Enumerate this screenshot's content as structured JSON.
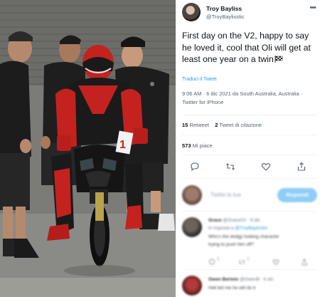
{
  "photo": {
    "description_icon": "photo-image",
    "bike_number": "1"
  },
  "tweet": {
    "author_name": "Troy Bayliss",
    "author_handle": "@TroyBaylisstic",
    "text": "First day on the V2, happy to say he loved it, cool that Oli will get at least one year on a twin",
    "translate_label": "Traduci il Tweet",
    "timestamp": "9:06 AM · 6 dic 2021 da South Australia, Australia · Twitter for iPhone",
    "retweets_count": "15",
    "retweets_label": "Retweet",
    "quotes_count": "2",
    "quotes_label": "Tweet di citazione",
    "likes_count": "573",
    "likes_label": "Mi piace"
  },
  "reply": {
    "placeholder": "Twitta la tua",
    "button_label": "Rispondi"
  },
  "comments": [
    {
      "name": "Grace",
      "handle": "@GraceXX · 6 dic",
      "reply_to_prefix": "In risposta a",
      "reply_to": "@TroyBaylisstic",
      "text_1": "Who's the dodgy looking character",
      "text_2": "trying to push him off?",
      "reply_count": "1",
      "retweet_count": "1"
    },
    {
      "name": "Owen Bertolo",
      "handle": "@OwenB · 6 dic",
      "text_1": "Hell tell me he will do it"
    }
  ],
  "colors": {
    "accent": "#1d9bf0",
    "text_primary": "#0f1419",
    "text_secondary": "#536471"
  }
}
